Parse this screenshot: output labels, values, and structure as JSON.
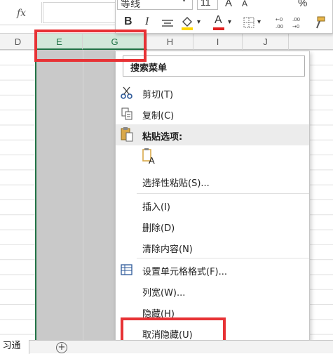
{
  "formula_bar": {
    "fx_label": "fx"
  },
  "columns": [
    "D",
    "E",
    "G",
    "H",
    "I",
    "J"
  ],
  "toolbar": {
    "font_name": "等线",
    "font_size": "11",
    "bold_label": "B",
    "italic_label": "I",
    "font_color_label": "A",
    "increase_font_label": "A",
    "decrease_font_label": "A",
    "percent_label": "%"
  },
  "context_menu": {
    "search_label": "搜索菜单",
    "items": [
      {
        "id": "cut",
        "label": "剪切(T)",
        "icon": "scissors-icon"
      },
      {
        "id": "copy",
        "label": "复制(C)",
        "icon": "copy-icon"
      },
      {
        "id": "paste_options",
        "label": "粘贴选项:",
        "icon": "paste-icon"
      },
      {
        "id": "paste_special",
        "label": "选择性粘贴(S)..."
      },
      {
        "id": "insert",
        "label": "插入(I)"
      },
      {
        "id": "delete",
        "label": "删除(D)"
      },
      {
        "id": "clear",
        "label": "清除内容(N)"
      },
      {
        "id": "format_cells",
        "label": "设置单元格格式(F)...",
        "icon": "format-cells-icon"
      },
      {
        "id": "col_width",
        "label": "列宽(W)..."
      },
      {
        "id": "hide",
        "label": "隐藏(H)"
      },
      {
        "id": "unhide",
        "label": "取消隐藏(U)"
      }
    ],
    "paste_glyph": "A"
  },
  "sheet_tabs": {
    "active": "习通",
    "add_label": "+"
  },
  "colors": {
    "accent_green": "#217346",
    "highlight_red": "#e73235",
    "selection_gray": "#c9c9c9",
    "font_color_red": "#e02020",
    "fill_yellow": "#ffd700"
  }
}
